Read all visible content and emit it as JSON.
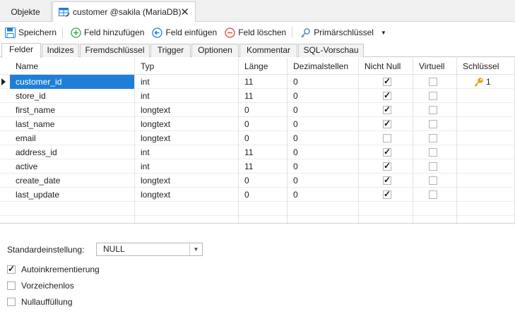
{
  "doc_tabs": {
    "objects": "Objekte",
    "active": "customer @sakila (MariaDB)"
  },
  "toolbar": {
    "save": "Speichern",
    "add_field": "Feld hinzufügen",
    "insert_field": "Feld einfügen",
    "delete_field": "Feld löschen",
    "primary_key": "Primärschlüssel"
  },
  "sub_tabs": [
    "Felder",
    "Indizes",
    "Fremdschlüssel",
    "Trigger",
    "Optionen",
    "Kommentar",
    "SQL-Vorschau"
  ],
  "columns": {
    "name": "Name",
    "type": "Typ",
    "length": "Länge",
    "decimals": "Dezimalstellen",
    "not_null": "Nicht Null",
    "virtual": "Virtuell",
    "key": "Schlüssel"
  },
  "rows": [
    {
      "name": "customer_id",
      "type": "int",
      "length": "11",
      "decimals": "0",
      "not_null": true,
      "virtual": false,
      "key": "1"
    },
    {
      "name": "store_id",
      "type": "int",
      "length": "11",
      "decimals": "0",
      "not_null": true,
      "virtual": false,
      "key": ""
    },
    {
      "name": "first_name",
      "type": "longtext",
      "length": "0",
      "decimals": "0",
      "not_null": true,
      "virtual": false,
      "key": ""
    },
    {
      "name": "last_name",
      "type": "longtext",
      "length": "0",
      "decimals": "0",
      "not_null": true,
      "virtual": false,
      "key": ""
    },
    {
      "name": "email",
      "type": "longtext",
      "length": "0",
      "decimals": "0",
      "not_null": false,
      "virtual": false,
      "key": ""
    },
    {
      "name": "address_id",
      "type": "int",
      "length": "11",
      "decimals": "0",
      "not_null": true,
      "virtual": false,
      "key": ""
    },
    {
      "name": "active",
      "type": "int",
      "length": "11",
      "decimals": "0",
      "not_null": true,
      "virtual": false,
      "key": ""
    },
    {
      "name": "create_date",
      "type": "longtext",
      "length": "0",
      "decimals": "0",
      "not_null": true,
      "virtual": false,
      "key": ""
    },
    {
      "name": "last_update",
      "type": "longtext",
      "length": "0",
      "decimals": "0",
      "not_null": true,
      "virtual": false,
      "key": ""
    }
  ],
  "properties": {
    "default_label": "Standardeinstellung:",
    "default_value": "NULL",
    "auto_increment": {
      "label": "Autoinkrementierung",
      "checked": true
    },
    "unsigned": {
      "label": "Vorzeichenlos",
      "checked": false
    },
    "zerofill": {
      "label": "Nullauffüllung",
      "checked": false
    }
  },
  "colors": {
    "selection": "#1f7fd6",
    "add_icon": "#2ea84a",
    "insert_icon": "#1e7fd8",
    "delete_icon": "#e0453a",
    "key_icon": "#e8a317"
  }
}
